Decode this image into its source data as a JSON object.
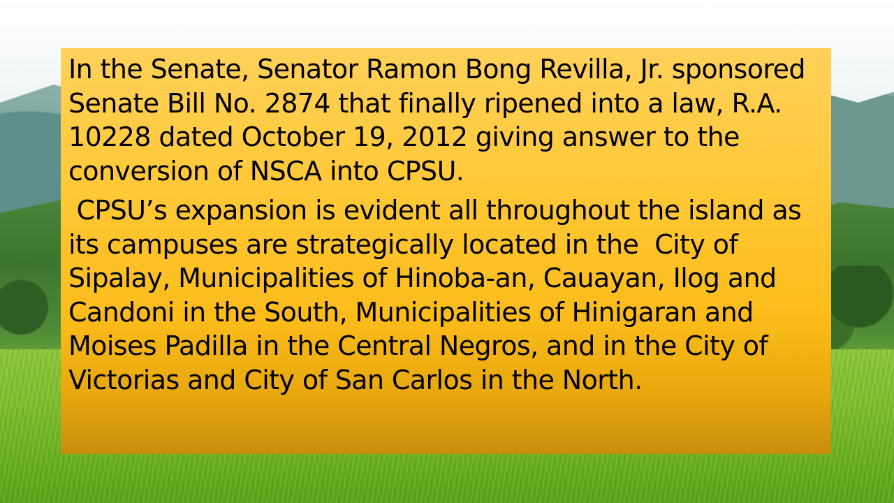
{
  "slide": {
    "paragraphs": [
      "In the Senate, Senator Ramon Bong Revilla, Jr. sponsored Senate Bill No. 2874 that finally ripened into a law, R.A. 10228 dated October 19, 2012 giving answer to the conversion of NSCA into CPSU.",
      " CPSU’s expansion is evident all throughout the island as its campuses are strategically located in the  City of Sipalay, Municipalities of Hinoba-an, Cauayan, Ilog and Candoni in the South, Municipalities of Hinigaran and Moises Padilla in the Central Negros, and in the City of Victorias and City of San Carlos in the North."
    ]
  },
  "colors": {
    "text_box_top": "#ffd15a",
    "text_box_bottom": "#c88e0c",
    "text": "#000000"
  }
}
